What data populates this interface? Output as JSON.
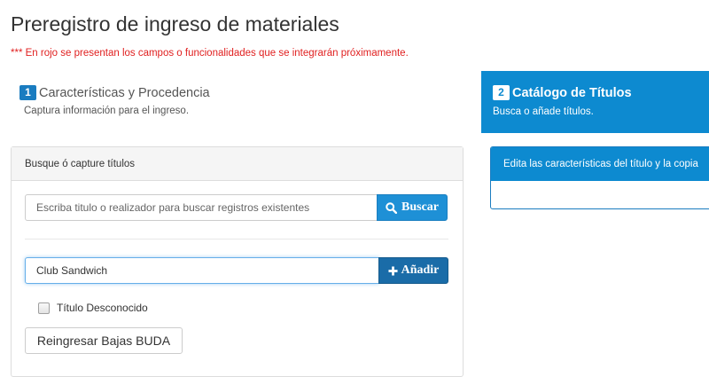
{
  "header": {
    "title": "Preregistro de ingreso de materiales",
    "notice": "*** En rojo se presentan los campos o funcionalidades que se integrarán próximamente."
  },
  "steps": [
    {
      "number": "1",
      "title": "Características y Procedencia",
      "subtitle": "Captura información para el ingreso."
    },
    {
      "number": "2",
      "title": "Catálogo de Títulos",
      "subtitle": "Busca o añade títulos."
    }
  ],
  "search_panel": {
    "heading": "Busque ó capture títulos",
    "search_placeholder": "Escriba titulo o realizador para buscar registros existentes",
    "search_button_label": "Buscar",
    "search_icon": "search-icon",
    "title_input_value": "Club Sandwich",
    "add_button_label": "Añadir",
    "add_icon": "plus-icon",
    "checkbox_label": "Título Desconocido",
    "checkbox_checked": false,
    "reingresar_label": "Reingresar Bajas BUDA"
  },
  "edit_panel": {
    "heading": "Edita las características del título y la copia"
  },
  "colors": {
    "accent": "#0d8ad0",
    "notice_red": "#e02020",
    "button_blue": "#1e90d6",
    "button_dark_blue": "#1a6ca8"
  }
}
